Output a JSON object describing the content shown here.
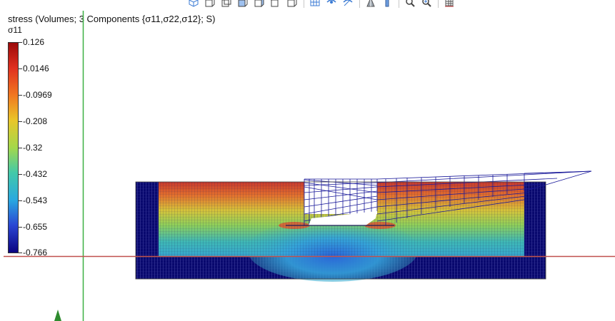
{
  "toolbar": {
    "buttons": [
      {
        "icon": "view-iso-icon"
      },
      {
        "icon": "view-front-icon"
      },
      {
        "icon": "view-back-icon"
      },
      {
        "icon": "view-left-icon"
      },
      {
        "icon": "view-right-icon"
      },
      {
        "icon": "view-top-icon"
      },
      {
        "icon": "view-bottom-icon"
      },
      {
        "icon": "mesh-display-icon"
      },
      {
        "icon": "show-all-icon"
      },
      {
        "icon": "hide-icon"
      },
      {
        "icon": "perspective-icon"
      },
      {
        "icon": "scale-icon"
      },
      {
        "icon": "zoom-icon"
      },
      {
        "icon": "zoom-extents-icon"
      },
      {
        "icon": "grid-settings-icon"
      }
    ]
  },
  "plot": {
    "title": "stress (Volumes; 3 Components {σ11,σ22,σ12}; S)",
    "field_label": "σ11",
    "colorbar": {
      "ticks": [
        "0.126",
        "0.0146",
        "-0.0969",
        "-0.208",
        "-0.32",
        "-0.432",
        "-0.543",
        "-0.655",
        "-0.766"
      ],
      "colors": [
        "#9b0a0a",
        "#e03020",
        "#f07820",
        "#e9c62a",
        "#a3d84b",
        "#43c9a9",
        "#29a8e0",
        "#2a46d3",
        "#0b0380"
      ]
    },
    "axis_colors": {
      "x_axis": "#c0504d",
      "y_axis": "#3cb043"
    }
  }
}
